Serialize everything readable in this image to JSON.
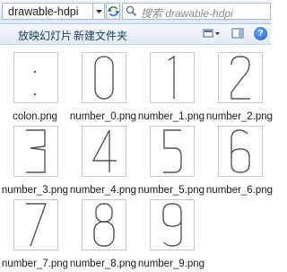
{
  "address": {
    "path": "drawable-hdpi",
    "search_placeholder": "搜索 drawable-hdpi"
  },
  "toolbar": {
    "slideshow_label": "放映幻灯片",
    "new_folder_label": "新建文件夹",
    "help_label": "?"
  },
  "files": [
    {
      "name": "colon.png",
      "glyph": ":"
    },
    {
      "name": "number_0.png",
      "glyph": "0"
    },
    {
      "name": "number_1.png",
      "glyph": "1"
    },
    {
      "name": "number_2.png",
      "glyph": "2"
    },
    {
      "name": "number_3.png",
      "glyph": "3"
    },
    {
      "name": "number_4.png",
      "glyph": "4"
    },
    {
      "name": "number_5.png",
      "glyph": "5"
    },
    {
      "name": "number_6.png",
      "glyph": "6"
    },
    {
      "name": "number_7.png",
      "glyph": "7"
    },
    {
      "name": "number_8.png",
      "glyph": "8"
    },
    {
      "name": "number_9.png",
      "glyph": "9"
    }
  ]
}
